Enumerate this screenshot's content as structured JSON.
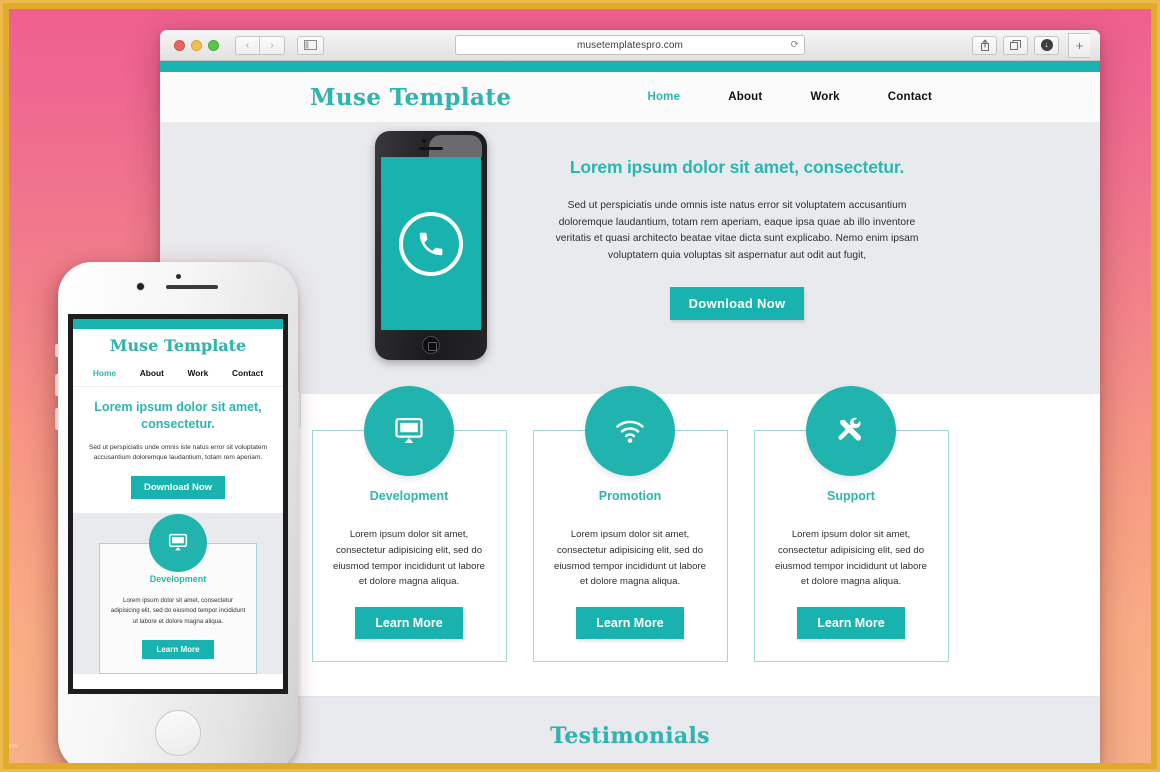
{
  "browser": {
    "url": "musetemplatespro.com",
    "reload_icon": "reload-icon",
    "back_icon": "‹",
    "forward_icon": "›",
    "sidebar_icon": "sidebar-icon",
    "share_icon": "share-icon",
    "tabs_icon": "tabs-icon",
    "download_icon": "download-icon",
    "newtab_icon": "+",
    "traffic_lights": [
      "close",
      "minimize",
      "zoom"
    ]
  },
  "site": {
    "logo": "Muse Template",
    "nav": [
      {
        "label": "Home",
        "active": true
      },
      {
        "label": "About",
        "active": false
      },
      {
        "label": "Work",
        "active": false
      },
      {
        "label": "Contact",
        "active": false
      }
    ],
    "hero": {
      "phone_icon": "phone-call-icon",
      "title": "Lorem ipsum dolor sit amet, consectetur.",
      "body": "Sed ut perspiciatis unde omnis iste natus error sit voluptatem accusantium doloremque laudantium, totam rem aperiam, eaque ipsa quae ab illo inventore veritatis et quasi architecto beatae vitae dicta sunt explicabo. Nemo enim ipsam voluptatem quia voluptas sit aspernatur aut odit aut fugit,",
      "cta": "Download Now"
    },
    "features": [
      {
        "icon": "desktop-monitor-icon",
        "title": "Development",
        "body": "Lorem ipsum dolor sit amet, consectetur adipisicing elit, sed do eiusmod tempor incididunt ut labore et dolore magna aliqua.",
        "cta": "Learn More"
      },
      {
        "icon": "wifi-icon",
        "title": "Promotion",
        "body": "Lorem ipsum dolor sit amet, consectetur adipisicing elit, sed do eiusmod tempor incididunt ut labore et dolore magna aliqua.",
        "cta": "Learn More"
      },
      {
        "icon": "tools-wrench-screwdriver-icon",
        "title": "Support",
        "body": "Lorem ipsum dolor sit amet, consectetur adipisicing elit, sed do eiusmod tempor incididunt ut labore et dolore magna aliqua.",
        "cta": "Learn More"
      }
    ],
    "testimonials": {
      "title": "Testimonials"
    }
  },
  "mobile": {
    "logo": "Muse Template",
    "nav": [
      {
        "label": "Home",
        "active": true
      },
      {
        "label": "About",
        "active": false
      },
      {
        "label": "Work",
        "active": false
      },
      {
        "label": "Contact",
        "active": false
      }
    ],
    "hero": {
      "title": "Lorem ipsum dolor sit amet, consectetur.",
      "body": "Sed ut perspiciatis unde omnis iste natus error sit voluptatem accusantium doloremque laudantium, totam rem aperiam.",
      "cta": "Download Now"
    },
    "feature": {
      "icon": "desktop-monitor-icon",
      "title": "Development",
      "body": "Lorem ipsum dolor sit amet, consectetur adipisicing elit, sed do eiusmod tempor incididunt ut labore et dolore magna aliqua.",
      "cta": "Learn More"
    }
  },
  "colors": {
    "teal": "#18b3ae",
    "teal_text": "#2bb6b0",
    "hero_bg": "#e9eaee",
    "frame_gold": "#e0aa2a",
    "bg_gradient_top": "#ef5f8f",
    "bg_gradient_bottom": "#f8b089"
  },
  "watermark": "www"
}
